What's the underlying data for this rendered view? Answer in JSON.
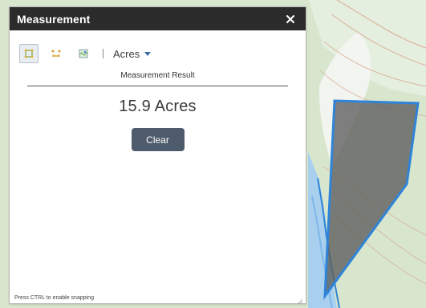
{
  "widget": {
    "title": "Measurement",
    "close_icon": "close-icon",
    "toolbar": {
      "tools": [
        {
          "name": "area-tool",
          "icon": "area-icon",
          "active": true
        },
        {
          "name": "distance-tool",
          "icon": "distance-icon",
          "active": false
        },
        {
          "name": "location-tool",
          "icon": "location-icon",
          "active": false
        }
      ],
      "unit_label": "Acres"
    },
    "result": {
      "label": "Measurement Result",
      "value": "15.9 Acres"
    },
    "clear_button": "Clear",
    "hint": "Press CTRL to enable snapping"
  },
  "colors": {
    "titlebar": "#2b2b2b",
    "clear_button": "#4e5b6d",
    "unit_caret": "#3f6ea8",
    "polygon_fill": "#5c5c5c",
    "polygon_stroke": "#2f84d8",
    "water": "#aacff0"
  }
}
